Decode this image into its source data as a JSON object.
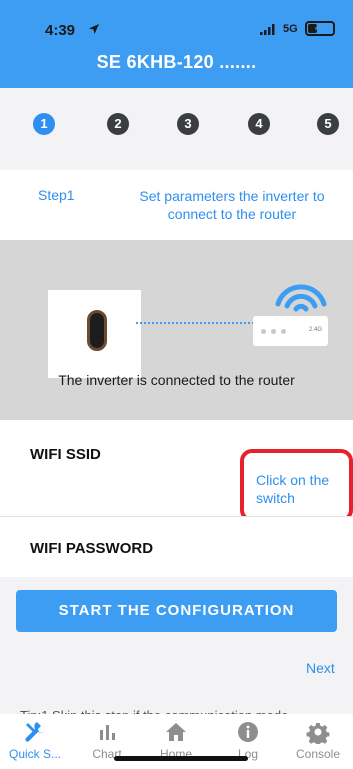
{
  "status_bar": {
    "time": "4:39",
    "network": "5G",
    "battery_level": "40"
  },
  "header": {
    "title": "SE 6KHB-120 ......."
  },
  "stepper": {
    "steps": [
      "1",
      "2",
      "3",
      "4",
      "5"
    ],
    "active_step": 1
  },
  "step_info": {
    "label": "Step1",
    "description": "Set parameters the inverter to connect to the router"
  },
  "illustration": {
    "router_band": "2.4G",
    "caption": "The inverter is connected to the router"
  },
  "form": {
    "ssid_label": "WIFI SSID",
    "switch_hint": "Click on the switch",
    "password_label": "WIFI PASSWORD"
  },
  "actions": {
    "start_label": "START THE CONFIGURATION",
    "next_label": "Next"
  },
  "tip": "Tip:1 Skip this step if the communication mode",
  "bottom_nav": {
    "items": [
      {
        "label": "Quick S...",
        "icon": "tools-icon"
      },
      {
        "label": "Chart",
        "icon": "bar-chart-icon"
      },
      {
        "label": "Home",
        "icon": "home-icon"
      },
      {
        "label": "Log",
        "icon": "info-icon"
      },
      {
        "label": "Console",
        "icon": "gear-icon"
      }
    ],
    "active_index": 0
  },
  "colors": {
    "accent": "#3d9df2",
    "link": "#2f8ff0",
    "highlight": "#e8222d"
  }
}
